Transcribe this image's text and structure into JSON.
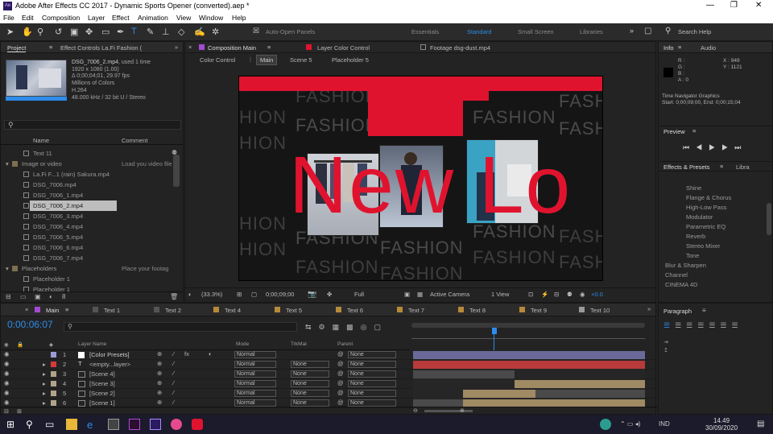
{
  "window": {
    "title": "Adobe After Effects CC 2017 - Dynamic Sports Opener (converted).aep *",
    "logo": "Ae"
  },
  "menu": [
    "File",
    "Edit",
    "Composition",
    "Layer",
    "Effect",
    "Animation",
    "View",
    "Window",
    "Help"
  ],
  "toolbar": {
    "auto_open": "Auto-Open Panels",
    "workspaces": [
      "Essentials",
      "Standard",
      "Small Screen",
      "Libraries"
    ],
    "search": "Search Help"
  },
  "project": {
    "tab_project": "Project",
    "tab_effect": "Effect Controls La.Fi Fashion (",
    "asset": {
      "name": "DSG_7006_2.mp4",
      "used": ", used 1 time",
      "dims": "1920 x 1080 (1.00)",
      "dur": "Δ 0;00;04;01, 29.97 fps",
      "colors": "Millions of Colors",
      "codec": "H.264",
      "audio": "48.000 kHz / 32 bit U / Stereo"
    },
    "col_name": "Name",
    "col_comment": "Comment",
    "items": [
      {
        "name": "Text 11",
        "desc": ""
      },
      {
        "name": "Image or video",
        "desc": "Load you video file"
      },
      {
        "name": "La.Fi F...1 (rain) Sakura.mp4",
        "desc": ""
      },
      {
        "name": "DSG_7006.mp4",
        "desc": ""
      },
      {
        "name": "DSG_7006_1.mp4",
        "desc": ""
      },
      {
        "name": "DSG_7006_2.mp4",
        "desc": ""
      },
      {
        "name": "DSG_7006_3.mp4",
        "desc": ""
      },
      {
        "name": "DSG_7006_4.mp4",
        "desc": ""
      },
      {
        "name": "DSG_7006_5.mp4",
        "desc": ""
      },
      {
        "name": "DSG_7006_6.mp4",
        "desc": ""
      },
      {
        "name": "DSG_7006_7.mp4",
        "desc": ""
      },
      {
        "name": "Placeholders",
        "desc": "Place your footag"
      },
      {
        "name": "Placeholder 1",
        "desc": ""
      },
      {
        "name": "Placeholder 1",
        "desc": ""
      }
    ]
  },
  "composition": {
    "tab_comp": "Composition Main",
    "tab_layer": "Layer Color Control",
    "tab_footage": "Footage dsg-dust.mp4",
    "crumbs": [
      "Color Control",
      "Main",
      "Scene 5",
      "Placeholder 5"
    ],
    "big_text": "New Lo",
    "fashion": [
      "FASHION",
      "FASHION",
      "FASHION",
      "FASHION",
      "FASHION",
      "FASH",
      "FASH",
      "HION",
      "HION",
      "HION",
      "HION",
      "FASHION",
      "FASHION",
      "FASHION",
      "FASHION",
      "FASH",
      "FASH"
    ],
    "footer": {
      "zoom": "(33.3%)",
      "time": "0;00;09;00",
      "quality": "Full",
      "camera": "Active Camera",
      "view": "1 View",
      "exposure": "+0.0"
    }
  },
  "right_panel": {
    "tab_info": "Info",
    "tab_audio": "Audio",
    "info_rgb": [
      "R :",
      "G :",
      "B :",
      "A : 0"
    ],
    "info_xy": [
      "X : 949",
      "Y : 1121"
    ],
    "info_note": "Time Navigator Graphics",
    "info_range": "Start: 0;00;09;00, End: 0;00;15;04",
    "preview": "Preview",
    "effects": "Effects & Presets",
    "libraries": "Libra",
    "effect_items": [
      "Shine",
      "Flange & Chorus",
      "High-Low Pass",
      "Modulator",
      "Parametric EQ",
      "Reverb",
      "Stereo Mixer",
      "Tone",
      "Blur & Sharpen",
      "Channel",
      "CINEMA 4D"
    ],
    "paragraph": "Paragraph"
  },
  "timeline": {
    "tabs": [
      "Main",
      "Text 1",
      "Text 2",
      "Text 4",
      "Text 5",
      "Text 6",
      "Text 7",
      "Text 8",
      "Text 9",
      "Text 10"
    ],
    "timecode": "0:00:06:07",
    "col_layer": "Layer Name",
    "col_mode": "Mode",
    "col_trkmat": "TrkMat",
    "col_parent": "Parent",
    "layers": [
      {
        "num": "1",
        "name": "[Color Presets]",
        "mode": "Normal",
        "trk": "",
        "parent": "None",
        "color": "#9b9bd6"
      },
      {
        "num": "2",
        "name": "<empty...layer>",
        "mode": "Normal",
        "trk": "None",
        "parent": "None",
        "color": "#d63a3a"
      },
      {
        "num": "3",
        "name": "[Scene 4]",
        "mode": "Normal",
        "trk": "None",
        "parent": "None",
        "color": "#b0a48a"
      },
      {
        "num": "4",
        "name": "[Scene 3]",
        "mode": "Normal",
        "trk": "None",
        "parent": "None",
        "color": "#b0a48a"
      },
      {
        "num": "5",
        "name": "[Scene 2]",
        "mode": "Normal",
        "trk": "None",
        "parent": "None",
        "color": "#b0a48a"
      },
      {
        "num": "6",
        "name": "[Scene 1]",
        "mode": "Normal",
        "trk": "None",
        "parent": "None",
        "color": "#b0a48a"
      }
    ]
  },
  "taskbar": {
    "time": "14.49",
    "date": "30/09/2020"
  },
  "colors": {
    "accent": "#2d8ceb",
    "red": "#e0132f",
    "bg": "#232323"
  }
}
